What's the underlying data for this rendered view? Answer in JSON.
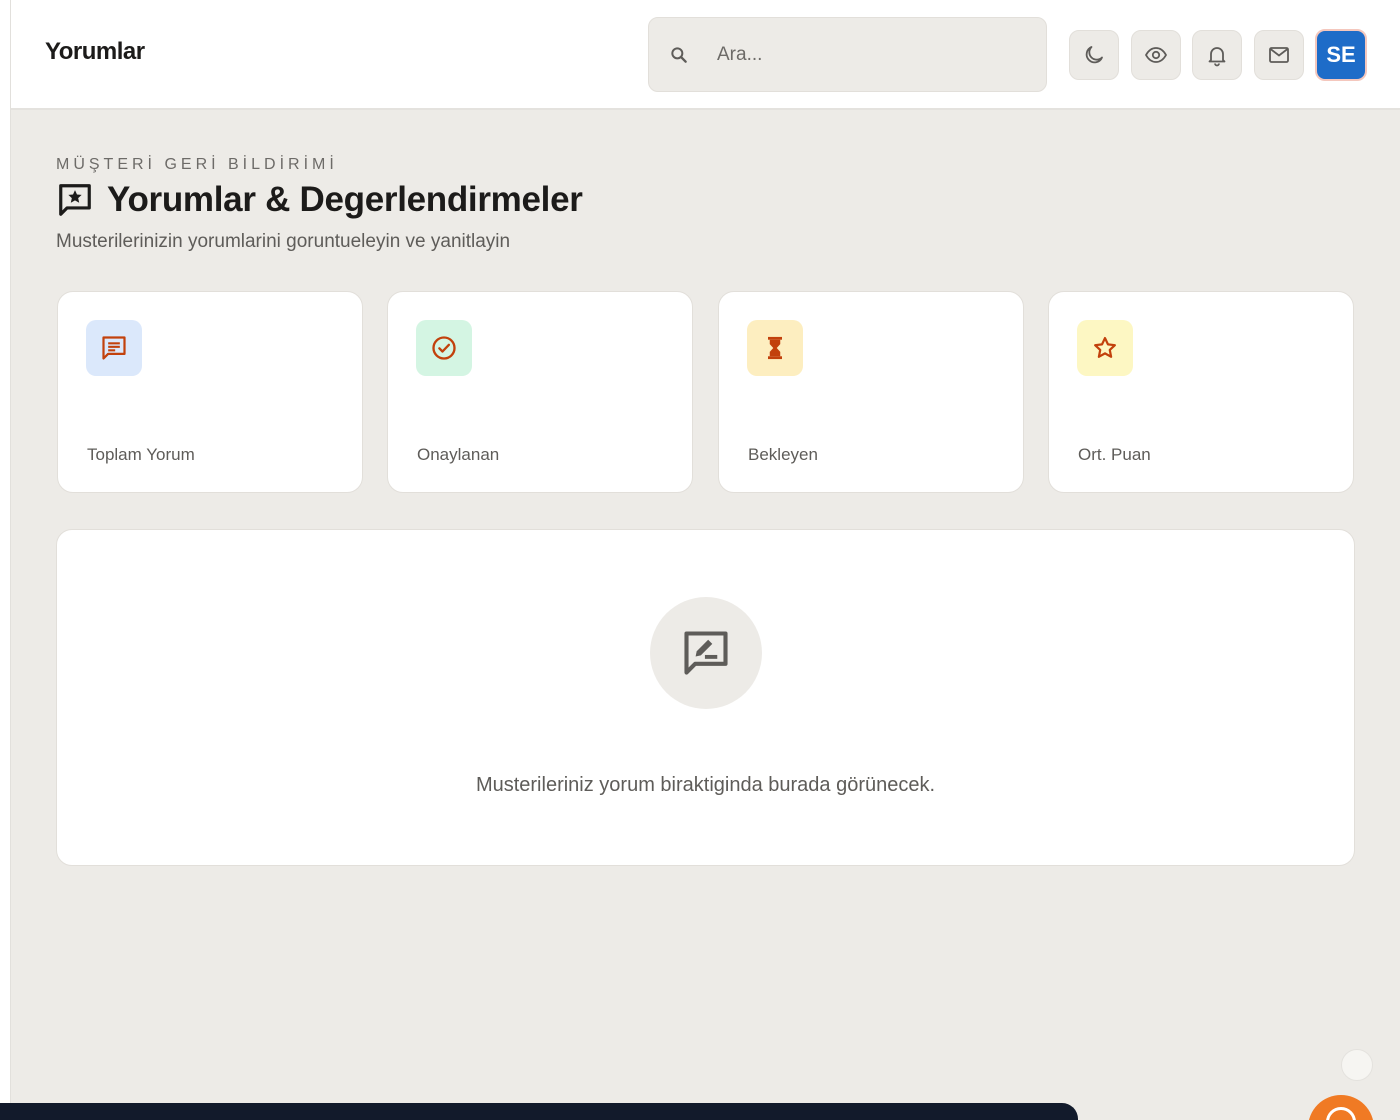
{
  "topbar": {
    "title": "Yorumlar",
    "search_placeholder": "Ara...",
    "avatar_initials": "SE"
  },
  "page": {
    "eyebrow": "MÜŞTERİ GERİ BİLDİRİMİ",
    "title": "Yorumlar & Degerlendirmeler",
    "subtitle": "Musterilerinizin yorumlarini goruntueleyin ve yanitlayin"
  },
  "stats": [
    {
      "label": "Toplam Yorum",
      "icon": "comment-icon",
      "icon_color": "#c2410c",
      "bg": "#dbe8fb"
    },
    {
      "label": "Onaylanan",
      "icon": "check-circle-icon",
      "icon_color": "#c2410c",
      "bg": "#d4f5e3"
    },
    {
      "label": "Bekleyen",
      "icon": "hourglass-icon",
      "icon_color": "#c2410c",
      "bg": "#fdeec0"
    },
    {
      "label": "Ort. Puan",
      "icon": "star-icon",
      "icon_color": "#c2410c",
      "bg": "#fdf7c3"
    }
  ],
  "empty_state": {
    "icon": "rate-review-icon",
    "message": "Musterileriniz yorum biraktiginda burada görünecek."
  },
  "colors": {
    "background": "#edebe7",
    "surface": "#ffffff",
    "accent": "#1e6cc8",
    "fab": "#f07a24",
    "icon_accent": "#c2410c"
  }
}
